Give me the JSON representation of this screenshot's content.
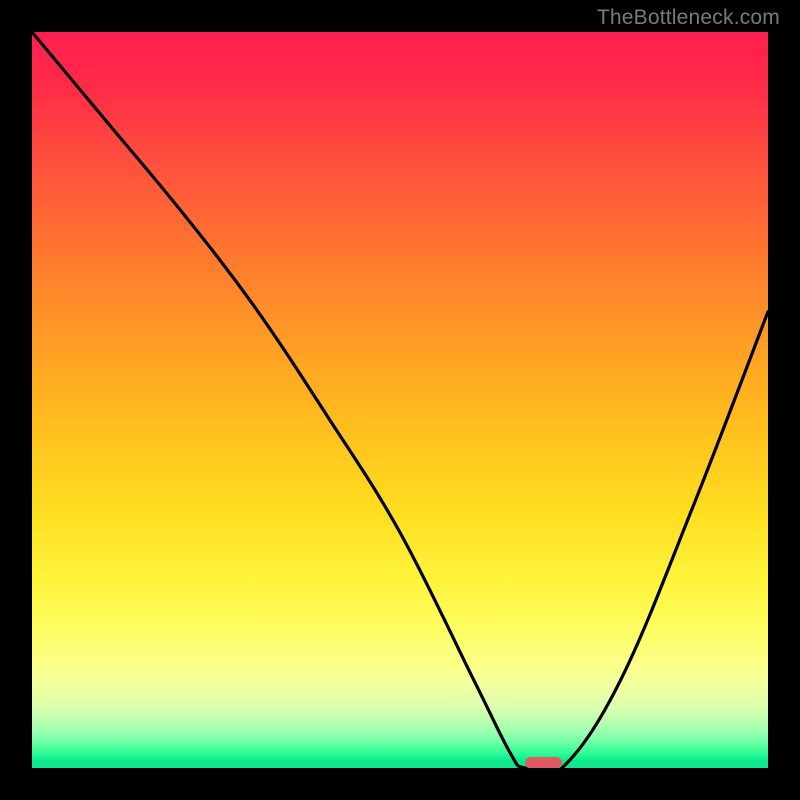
{
  "watermark": "TheBottleneck.com",
  "chart_data": {
    "type": "line",
    "title": "",
    "xlabel": "",
    "ylabel": "",
    "xlim": [
      0,
      100
    ],
    "ylim": [
      0,
      100
    ],
    "grid": false,
    "legend": false,
    "series": [
      {
        "name": "bottleneck-curve",
        "x": [
          0,
          10,
          20,
          30,
          40,
          50,
          60,
          65,
          67,
          72,
          80,
          90,
          100
        ],
        "y": [
          100,
          88,
          76,
          63,
          48,
          32,
          12,
          2,
          0,
          0,
          12,
          36,
          62
        ]
      }
    ],
    "marker": {
      "name": "optimal-pill",
      "x_center": 69.5,
      "y": 0.7,
      "width_pct": 5.0,
      "height_pct": 1.6,
      "color": "#e05a62"
    },
    "background_gradient": {
      "top": "#ff1f4f",
      "mid": "#ffe022",
      "bottom": "#0fe98c"
    }
  }
}
